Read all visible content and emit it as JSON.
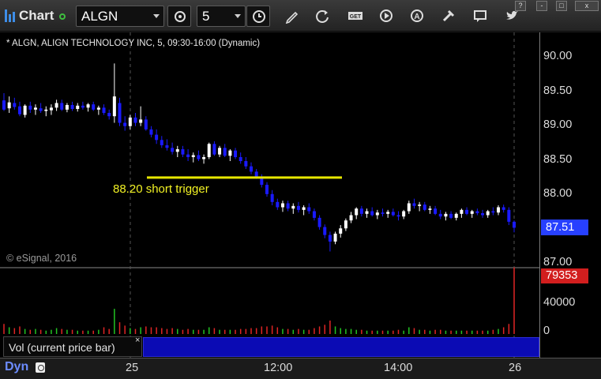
{
  "app": {
    "title": "Chart"
  },
  "toolbar": {
    "symbol": "ALGN",
    "interval": "5",
    "icons": [
      "settings-icon",
      "clock-icon",
      "pencil-icon",
      "refresh-icon",
      "get-icon",
      "play-icon",
      "alert-icon",
      "tools-icon",
      "comment-icon",
      "twitter-icon"
    ],
    "window_buttons": [
      "?",
      "-",
      "□",
      "x"
    ]
  },
  "chart": {
    "caption": "* ALGN, ALIGN TECHNOLOGY INC, 5, 09:30-16:00 (Dynamic)",
    "copyright": "© eSignal, 2016",
    "annotation": "88.20 short trigger",
    "trigger_price": 88.27,
    "price_labels": [
      "90.00",
      "89.50",
      "89.00",
      "88.50",
      "88.00",
      "87.00"
    ],
    "last_price": "87.51",
    "volume_labels": [
      "40000",
      "0"
    ],
    "last_volume": "79353",
    "time_labels": [
      "25",
      "12:00",
      "14:00",
      "26"
    ],
    "colors": {
      "up": "#ffffff",
      "down": "#1a1aff",
      "trigger_line": "#e6e600",
      "vol_up": "#22c422",
      "vol_down": "#e02424"
    }
  },
  "volume_panel": {
    "label": "Vol (current price bar)",
    "close_symbol": "×"
  },
  "footer": {
    "mode_label": "Dyn"
  },
  "chart_data": {
    "type": "candlestick",
    "title": "ALGN, ALIGN TECHNOLOGY INC, 5, 09:30-16:00 (Dynamic)",
    "ylim": [
      87.0,
      90.1
    ],
    "volume_ylim": [
      0,
      80000
    ],
    "bars": [
      [
        89.44,
        89.55,
        89.28,
        89.3,
        12000
      ],
      [
        89.32,
        89.5,
        89.25,
        89.41,
        8000
      ],
      [
        89.4,
        89.48,
        89.3,
        89.34,
        7000
      ],
      [
        89.35,
        89.42,
        89.2,
        89.23,
        9000
      ],
      [
        89.22,
        89.38,
        89.18,
        89.36,
        6000
      ],
      [
        89.36,
        89.42,
        89.25,
        89.3,
        5000
      ],
      [
        89.3,
        89.38,
        89.22,
        89.33,
        6000
      ],
      [
        89.32,
        89.4,
        89.25,
        89.28,
        5000
      ],
      [
        89.28,
        89.35,
        89.2,
        89.3,
        4000
      ],
      [
        89.29,
        89.38,
        89.22,
        89.33,
        5000
      ],
      [
        89.33,
        89.45,
        89.28,
        89.4,
        7000
      ],
      [
        89.4,
        89.45,
        89.28,
        89.3,
        6000
      ],
      [
        89.3,
        89.4,
        89.26,
        89.37,
        5000
      ],
      [
        89.37,
        89.42,
        89.28,
        89.31,
        5000
      ],
      [
        89.31,
        89.4,
        89.27,
        89.36,
        4000
      ],
      [
        89.36,
        89.42,
        89.3,
        89.33,
        4000
      ],
      [
        89.33,
        89.4,
        89.27,
        89.38,
        4000
      ],
      [
        89.38,
        89.42,
        89.28,
        89.3,
        4000
      ],
      [
        89.3,
        89.36,
        89.22,
        89.33,
        5000
      ],
      [
        89.33,
        89.38,
        89.22,
        89.25,
        8000
      ],
      [
        89.25,
        89.3,
        89.15,
        89.2,
        6000
      ],
      [
        89.2,
        90.0,
        89.1,
        89.5,
        30000
      ],
      [
        89.4,
        89.48,
        89.05,
        89.1,
        14000
      ],
      [
        89.1,
        89.2,
        88.98,
        89.05,
        10000
      ],
      [
        89.05,
        89.22,
        89.0,
        89.18,
        7000
      ],
      [
        89.18,
        89.25,
        89.05,
        89.1,
        6000
      ],
      [
        89.1,
        89.35,
        89.05,
        89.15,
        8000
      ],
      [
        89.15,
        89.2,
        88.98,
        89.0,
        9000
      ],
      [
        89.0,
        89.05,
        88.88,
        88.92,
        8000
      ],
      [
        88.92,
        89.0,
        88.78,
        88.84,
        8000
      ],
      [
        88.84,
        88.9,
        88.72,
        88.76,
        7000
      ],
      [
        88.76,
        88.85,
        88.68,
        88.72,
        6000
      ],
      [
        88.72,
        88.8,
        88.62,
        88.66,
        7000
      ],
      [
        88.66,
        88.75,
        88.58,
        88.7,
        6000
      ],
      [
        88.7,
        88.75,
        88.58,
        88.62,
        5000
      ],
      [
        88.62,
        88.7,
        88.52,
        88.58,
        6000
      ],
      [
        88.58,
        88.65,
        88.5,
        88.61,
        5000
      ],
      [
        88.61,
        88.68,
        88.52,
        88.55,
        5000
      ],
      [
        88.55,
        88.62,
        88.48,
        88.58,
        5000
      ],
      [
        88.58,
        88.8,
        88.55,
        88.78,
        8000
      ],
      [
        88.78,
        88.82,
        88.6,
        88.62,
        7000
      ],
      [
        88.62,
        88.75,
        88.58,
        88.72,
        5000
      ],
      [
        88.72,
        88.78,
        88.58,
        88.6,
        5000
      ],
      [
        88.6,
        88.7,
        88.52,
        88.68,
        5000
      ],
      [
        88.68,
        88.72,
        88.55,
        88.58,
        5000
      ],
      [
        88.58,
        88.65,
        88.48,
        88.52,
        6000
      ],
      [
        88.52,
        88.58,
        88.4,
        88.44,
        6000
      ],
      [
        88.44,
        88.5,
        88.32,
        88.36,
        7000
      ],
      [
        88.36,
        88.4,
        88.25,
        88.28,
        7000
      ],
      [
        88.28,
        88.32,
        88.12,
        88.16,
        9000
      ],
      [
        88.16,
        88.2,
        87.98,
        88.02,
        9000
      ],
      [
        88.02,
        88.08,
        87.85,
        87.9,
        10000
      ],
      [
        87.9,
        87.95,
        87.78,
        87.82,
        8000
      ],
      [
        87.82,
        87.92,
        87.75,
        87.88,
        6000
      ],
      [
        87.88,
        87.92,
        87.76,
        87.8,
        6000
      ],
      [
        87.8,
        87.88,
        87.72,
        87.84,
        5000
      ],
      [
        87.84,
        87.9,
        87.74,
        87.78,
        6000
      ],
      [
        87.78,
        87.85,
        87.7,
        87.82,
        5000
      ],
      [
        87.82,
        87.88,
        87.72,
        87.76,
        5000
      ],
      [
        87.76,
        87.8,
        87.62,
        87.66,
        7000
      ],
      [
        87.66,
        87.7,
        87.48,
        87.52,
        9000
      ],
      [
        87.52,
        87.56,
        87.35,
        87.4,
        11000
      ],
      [
        87.4,
        87.45,
        87.15,
        87.3,
        16000
      ],
      [
        87.3,
        87.45,
        87.26,
        87.42,
        9000
      ],
      [
        87.42,
        87.55,
        87.36,
        87.5,
        7000
      ],
      [
        87.5,
        87.65,
        87.46,
        87.62,
        6000
      ],
      [
        87.62,
        87.75,
        87.58,
        87.7,
        6000
      ],
      [
        87.7,
        87.82,
        87.64,
        87.8,
        5000
      ],
      [
        87.8,
        87.84,
        87.68,
        87.72,
        5000
      ],
      [
        87.72,
        87.8,
        87.66,
        87.76,
        4000
      ],
      [
        87.76,
        87.82,
        87.68,
        87.7,
        4000
      ],
      [
        87.7,
        87.78,
        87.64,
        87.74,
        4000
      ],
      [
        87.74,
        87.8,
        87.68,
        87.72,
        4000
      ],
      [
        87.72,
        87.78,
        87.66,
        87.75,
        4000
      ],
      [
        87.75,
        87.8,
        87.68,
        87.7,
        4000
      ],
      [
        87.7,
        87.76,
        87.62,
        87.68,
        5000
      ],
      [
        87.68,
        87.78,
        87.64,
        87.76,
        4000
      ],
      [
        87.76,
        87.92,
        87.72,
        87.88,
        8000
      ],
      [
        87.88,
        87.95,
        87.8,
        87.84,
        7000
      ],
      [
        87.84,
        87.9,
        87.76,
        87.86,
        5000
      ],
      [
        87.86,
        87.9,
        87.76,
        87.78,
        5000
      ],
      [
        87.78,
        87.84,
        87.72,
        87.8,
        4000
      ],
      [
        87.8,
        87.84,
        87.7,
        87.72,
        5000
      ],
      [
        87.72,
        87.78,
        87.64,
        87.68,
        5000
      ],
      [
        87.68,
        87.75,
        87.62,
        87.72,
        4000
      ],
      [
        87.72,
        87.76,
        87.64,
        87.66,
        4000
      ],
      [
        87.66,
        87.74,
        87.62,
        87.72,
        4000
      ],
      [
        87.72,
        87.8,
        87.66,
        87.78,
        4000
      ],
      [
        87.78,
        87.82,
        87.7,
        87.72,
        4000
      ],
      [
        87.72,
        87.78,
        87.66,
        87.76,
        4000
      ],
      [
        87.76,
        87.8,
        87.7,
        87.73,
        4000
      ],
      [
        87.73,
        87.78,
        87.66,
        87.7,
        4000
      ],
      [
        87.7,
        87.78,
        87.66,
        87.76,
        4000
      ],
      [
        87.76,
        87.82,
        87.7,
        87.74,
        5000
      ],
      [
        87.74,
        87.85,
        87.7,
        87.82,
        6000
      ],
      [
        87.82,
        87.86,
        87.74,
        87.78,
        8000
      ],
      [
        87.78,
        87.82,
        87.55,
        87.6,
        12000
      ],
      [
        87.6,
        87.62,
        87.44,
        87.51,
        79353
      ]
    ]
  }
}
